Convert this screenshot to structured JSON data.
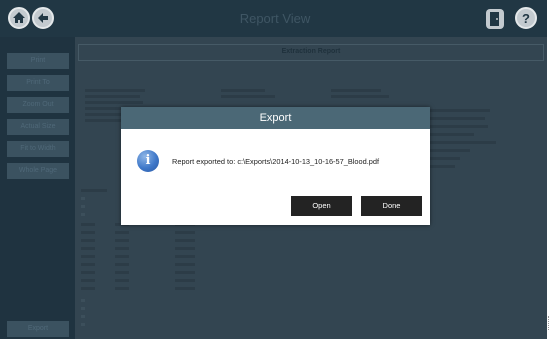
{
  "header": {
    "title": "Report View"
  },
  "sidebar": {
    "items": [
      {
        "label": "Print"
      },
      {
        "label": "Print To"
      },
      {
        "label": "Zoom Out"
      },
      {
        "label": "Actual Size"
      },
      {
        "label": "Fit to Width"
      },
      {
        "label": "Whole Page"
      }
    ],
    "export_label": "Export"
  },
  "report": {
    "title": "Extraction Report"
  },
  "dialog": {
    "title": "Export",
    "message": "Report exported to: c:\\Exports\\2014-10-13_10-16-57_Blood.pdf",
    "open_label": "Open",
    "done_label": "Done"
  },
  "colors": {
    "topbar": "#213744",
    "sidebar": "#1f3340",
    "dialog_title_bar": "#4b6876",
    "dialog_button": "#232323"
  }
}
